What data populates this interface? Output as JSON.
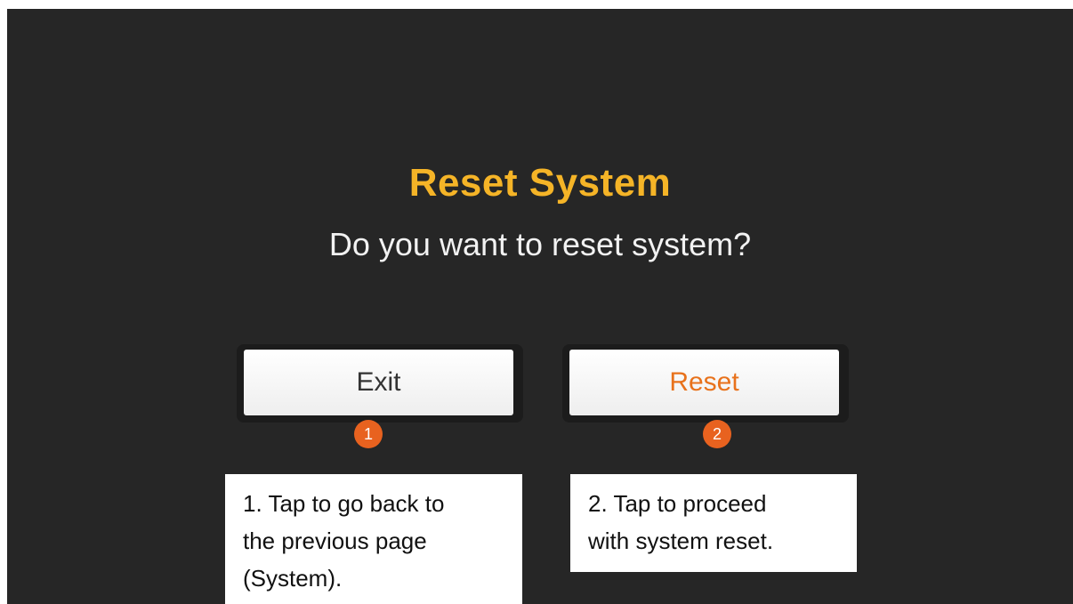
{
  "dialog": {
    "title": "Reset System",
    "message": "Do you want to reset system?"
  },
  "buttons": {
    "exit_label": "Exit",
    "reset_label": "Reset"
  },
  "markers": {
    "exit": "1",
    "reset": "2"
  },
  "callouts": {
    "exit_line1": "1. Tap to go back to",
    "exit_line2": "the previous page",
    "exit_line3": "(System).",
    "reset_line1": "2. Tap to proceed",
    "reset_line2": "with system reset."
  },
  "colors": {
    "background": "#262626",
    "title": "#f5b427",
    "reset_label": "#e8721c",
    "marker": "#e8621f"
  }
}
